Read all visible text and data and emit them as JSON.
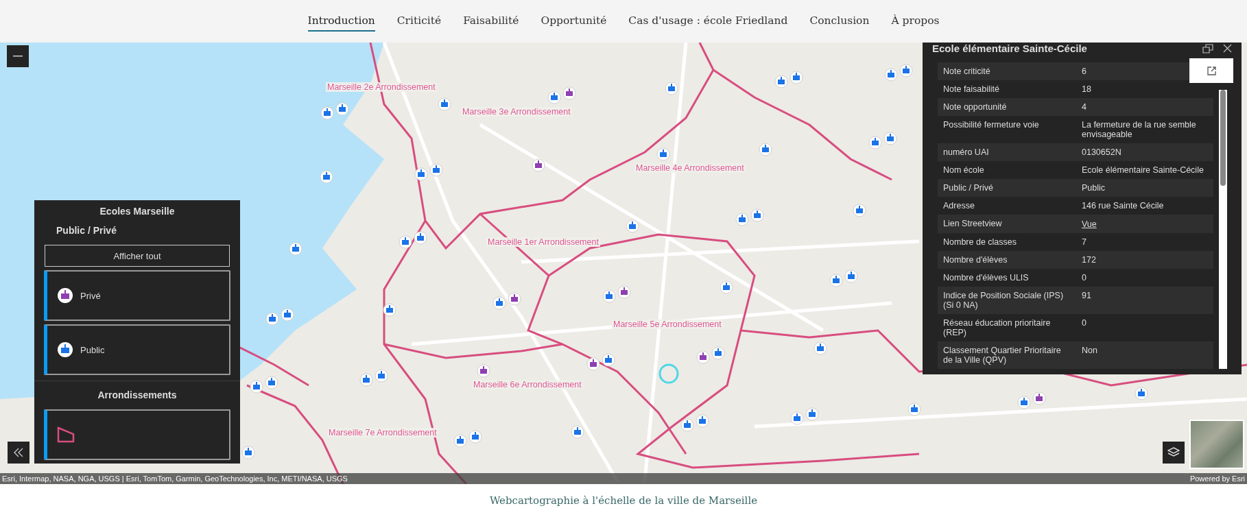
{
  "nav": {
    "tabs": [
      {
        "label": "Introduction",
        "selected": true
      },
      {
        "label": "Criticité",
        "selected": false
      },
      {
        "label": "Faisabilité",
        "selected": false
      },
      {
        "label": "Opportunité",
        "selected": false
      },
      {
        "label": "Cas d'usage : école Friedland",
        "selected": false
      },
      {
        "label": "Conclusion",
        "selected": false
      },
      {
        "label": "À propos",
        "selected": false
      }
    ]
  },
  "map": {
    "district_labels": [
      "Marseille 2e Arrondissement",
      "Marseille 3e Arrondissement",
      "Marseille 4e Arrondissement",
      "Marseille 1er Arrondissement",
      "Marseille 5e Arrondissement",
      "Marseille 6e Arrondissement",
      "Marseille 7e Arrondissement"
    ],
    "attribution": "Esri, Intermap, NASA, NGA, USGS | Esri, TomTom, Garmin, GeoTechnologies, Inc, METI/NASA, USGS",
    "powered_by": "Powered by Esri"
  },
  "legend": {
    "title": "Ecoles Marseille",
    "layers": [
      {
        "title": "Public / Privé",
        "filter_button": "Afficher tout",
        "items": [
          {
            "kind": "private",
            "label": "Privé"
          },
          {
            "kind": "public",
            "label": "Public"
          }
        ]
      },
      {
        "title": "Arrondissements",
        "items": [
          {
            "kind": "district"
          }
        ]
      }
    ]
  },
  "popup": {
    "title": "Ecole élémentaire Sainte-Cécile",
    "rows": [
      {
        "field": "Note criticité",
        "value": "6",
        "kind": "text"
      },
      {
        "field": "Note faisabilité",
        "value": "18",
        "kind": "text"
      },
      {
        "field": "Note opportunité",
        "value": "4",
        "kind": "text"
      },
      {
        "field": "Possibilité fermeture voie",
        "value": "La fermeture de la rue semble envisageable",
        "kind": "text"
      },
      {
        "field": "numéro UAI",
        "value": "0130652N",
        "kind": "text"
      },
      {
        "field": "Nom école",
        "value": "Ecole élémentaire Sainte-Cécile",
        "kind": "text"
      },
      {
        "field": "Public / Privé",
        "value": "Public",
        "kind": "text"
      },
      {
        "field": "Adresse",
        "value": "146 rue Sainte Cécile",
        "kind": "text"
      },
      {
        "field": "Lien Streetview",
        "value": "Vue",
        "kind": "link"
      },
      {
        "field": "Nombre de classes",
        "value": "7",
        "kind": "text"
      },
      {
        "field": "Nombre d'élèves",
        "value": "172",
        "kind": "text"
      },
      {
        "field": "Nombre d'élèves ULIS",
        "value": "0",
        "kind": "text"
      },
      {
        "field": "Indice de Position Sociale (IPS) (Si 0 NA)",
        "value": "91",
        "kind": "text"
      },
      {
        "field": "Réseau éducation prioritaire (REP)",
        "value": "0",
        "kind": "text"
      },
      {
        "field": "Classement Quartier Prioritaire de la Ville (QPV)",
        "value": "Non",
        "kind": "text"
      }
    ]
  },
  "caption": "Webcartographie à l'échelle de la ville de Marseille"
}
